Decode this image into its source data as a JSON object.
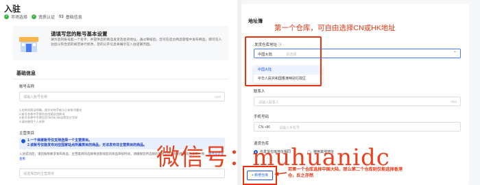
{
  "page": {
    "title": "入驻",
    "steps": [
      {
        "label": "市场选择",
        "done": true
      },
      {
        "label": "资质认证",
        "done": true
      },
      {
        "num": "03",
        "label": "基础信息",
        "done": false
      }
    ]
  },
  "intro": {
    "title": "请填写您的账号基本设置",
    "text": "请为您的账号起一个名字，并提供您的商品发货及退货地址，通过审核后，您可在后台商品管理中发布商品，即可在入驻后以符合您的规范进行修改，您的公开信息将展示在入驻店铺页面。"
  },
  "basic": {
    "section_title": "基础信息",
    "account_label": "账号名称",
    "account_placeholder": "请输入账号名称",
    "account_counter": "0/40",
    "hints": [
      "1.名称须简洁明确，账号名称不能与已有账号重名",
      "2.账号名称中不得包含违规及违禁词",
      "3.账号名称中不得包含TikTok Shop等官方字样",
      "4.请勿使用个人名称"
    ],
    "main_label": "主营类目",
    "notice_lines": [
      "1.一个商家账号仅支持选择一个主营类目。",
      "2.该账号仅能发布对应国家站点所属类目的商品，无法发布非主营类目的商品。"
    ],
    "note_text": "入驻成功后，请您按照要求发布商品，主营类目的选择将会影响您的商品审核时效，请确保您所选择的类目与您实际销售的商品类目一致。",
    "note_link": "请点击这里查看",
    "main_placeholder": "请选择您的主营类目"
  },
  "address": {
    "section_title": "地址簿",
    "annotation_top": "第一个仓库，可自由选择CN或HK地址",
    "wh_label": "发货仓库地址 ⓘ",
    "select_value": "中国大陆",
    "select_placeholder": "请选择",
    "options": [
      "中国大陆",
      "中华人民共和国香港特别行政区"
    ],
    "contact_label": "联系人",
    "contact_placeholder": "请输入联系人",
    "contact_counter": "0/50",
    "phone_label": "手机号码",
    "phone_prefix": "CN +86",
    "phone_placeholder": "请输入手机号",
    "return_label": "退货仓库",
    "radio_same": "与发货仓库地址相同",
    "radio_other": "使用其他地址",
    "add_btn": "+ 新增仓库",
    "annotation_bottom": "若第一个仓库选择中国大陆，那么第二个仓库则仅能选择香港仓，反之亦然"
  },
  "watermark": "微信号：muhuanidc",
  "colors": {
    "accent": "#1a55e0",
    "annotation": "#e8330f",
    "success": "#3bb54a"
  }
}
